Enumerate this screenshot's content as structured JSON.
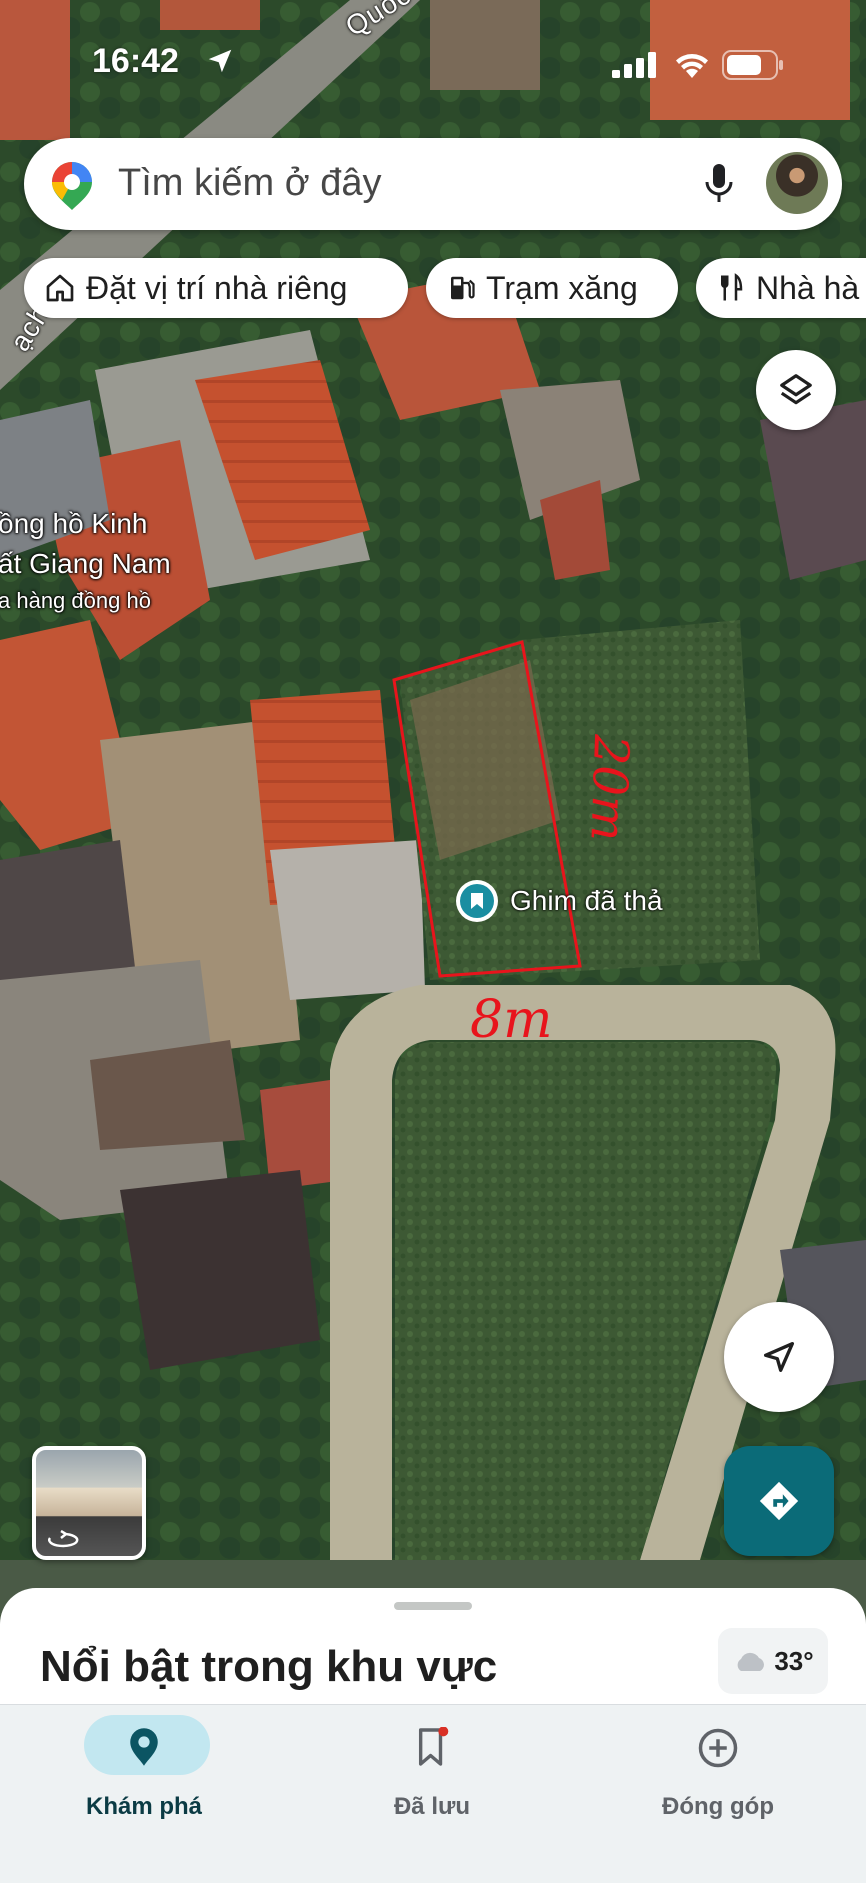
{
  "status_bar": {
    "time": "16:42"
  },
  "search": {
    "placeholder": "Tìm kiếm ở đây"
  },
  "chips": [
    {
      "label": "Đặt vị trí nhà riêng",
      "icon": "home-icon"
    },
    {
      "label": "Trạm xăng",
      "icon": "gas-station-icon"
    },
    {
      "label": "Nhà hà",
      "icon": "restaurant-icon"
    }
  ],
  "map": {
    "street_top": "Quốc",
    "street_left": "ạch Ký",
    "poi_lines": [
      "ồng hồ Kinh",
      "ất Giang Nam",
      "a hàng đồng hồ"
    ],
    "pin_label": "Ghim đã thả",
    "annotation_width": "8m",
    "annotation_length": "20m",
    "annotation_color": "#e8141c"
  },
  "sheet": {
    "title": "Nổi bật trong khu vực",
    "weather": "33°"
  },
  "nav": {
    "items": [
      {
        "label": "Khám phá",
        "active": true
      },
      {
        "label": "Đã lưu",
        "active": false
      },
      {
        "label": "Đóng góp",
        "active": false
      }
    ]
  },
  "colors": {
    "accent": "#0b6b78",
    "active_pill": "#c2e7f0",
    "nav_active_text": "#0b3b44",
    "nav_text": "#5f6368",
    "notification_dot": "#d93025"
  }
}
